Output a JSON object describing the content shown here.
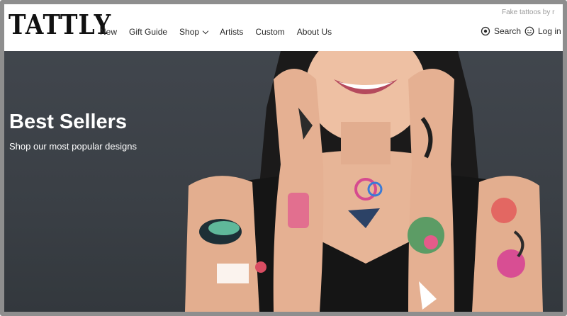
{
  "brand": {
    "logo_text": "TATTLY",
    "trademark": "™"
  },
  "header": {
    "tagline": "Fake tattoos by r",
    "nav": [
      {
        "label": "New"
      },
      {
        "label": "Gift Guide"
      },
      {
        "label": "Shop",
        "has_dropdown": true
      },
      {
        "label": "Artists"
      },
      {
        "label": "Custom"
      },
      {
        "label": "About Us"
      }
    ],
    "search_label": "Search",
    "login_label": "Log in"
  },
  "hero": {
    "title": "Best Sellers",
    "subtitle": "Shop our most popular designs"
  },
  "icons": {
    "search": "search-icon",
    "login": "smiley-user-icon",
    "dropdown": "chevron-down-icon"
  },
  "colors": {
    "hero_background": "#3b4046",
    "text_dark": "#2a2a2a",
    "tagline": "#9a9a9a",
    "frame": "#8e8e8e"
  }
}
